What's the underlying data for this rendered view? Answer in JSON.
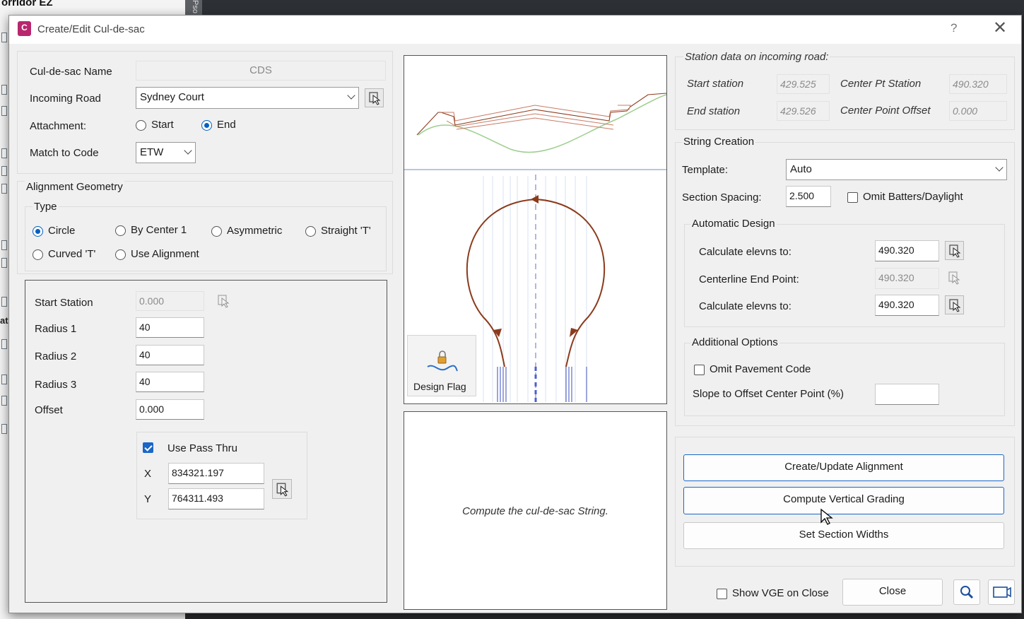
{
  "background": {
    "title": "orridor EZ",
    "strip_text": "Pso",
    "side_text": "at"
  },
  "dialog": {
    "title": "Create/Edit Cul-de-sac",
    "help": "?",
    "close": "✕"
  },
  "top_form": {
    "name_label": "Cul-de-sac Name",
    "name_value": "CDS",
    "road_label": "Incoming Road",
    "road_value": "Sydney Court",
    "attachment_label": "Attachment:",
    "attachment_options": [
      "Start",
      "End"
    ],
    "attachment_selected": "End",
    "match_label": "Match to Code",
    "match_value": "ETW"
  },
  "alignment": {
    "group_label": "Alignment Geometry",
    "type_label": "Type",
    "types": [
      "Circle",
      "By Center 1",
      "Asymmetric",
      "Straight 'T'",
      "Curved 'T'",
      "Use Alignment"
    ],
    "selected_type": "Circle"
  },
  "geometry": {
    "start_station_label": "Start Station",
    "start_station_value": "0.000",
    "radius1_label": "Radius 1",
    "radius1_value": "40",
    "radius2_label": "Radius 2",
    "radius2_value": "40",
    "radius3_label": "Radius 3",
    "radius3_value": "40",
    "offset_label": "Offset",
    "offset_value": "0.000",
    "pass_thru_label": "Use Pass Thru",
    "pass_thru_checked": true,
    "x_label": "X",
    "x_value": "834321.197",
    "y_label": "Y",
    "y_value": "764311.493"
  },
  "preview": {
    "design_flag_label": "Design Flag",
    "message": "Compute the cul-de-sac String."
  },
  "station_data": {
    "header": "Station data on incoming road:",
    "start_station_label": "Start station",
    "start_station_value": "429.525",
    "end_station_label": "End station",
    "end_station_value": "429.526",
    "center_pt_station_label": "Center Pt Station",
    "center_pt_station_value": "490.320",
    "center_point_offset_label": "Center Point Offset",
    "center_point_offset_value": "0.000"
  },
  "string_creation": {
    "header": "String Creation",
    "template_label": "Template:",
    "template_value": "Auto",
    "spacing_label": "Section Spacing:",
    "spacing_value": "2.500",
    "omit_batters_label": "Omit Batters/Daylight",
    "omit_batters_checked": false,
    "auto_design_header": "Automatic Design",
    "calc1_label": "Calculate elevns to:",
    "calc1_value": "490.320",
    "centerline_end_label": "Centerline End Point:",
    "centerline_end_value": "490.320",
    "calc2_label": "Calculate elevns to:",
    "calc2_value": "490.320",
    "additional_header": "Additional Options",
    "omit_pavement_label": "Omit Pavement Code",
    "omit_pavement_checked": false,
    "slope_label": "Slope to Offset Center Point (%)",
    "slope_value": ""
  },
  "actions": {
    "create_alignment": "Create/Update Alignment",
    "compute_vertical": "Compute Vertical Grading",
    "set_widths": "Set Section Widths",
    "show_vge_label": "Show VGE on Close",
    "show_vge_checked": false,
    "close": "Close"
  },
  "colors": {
    "accent": "#1a66c9",
    "curve": "#8b3b1c",
    "ground": "#9ccf8c"
  }
}
